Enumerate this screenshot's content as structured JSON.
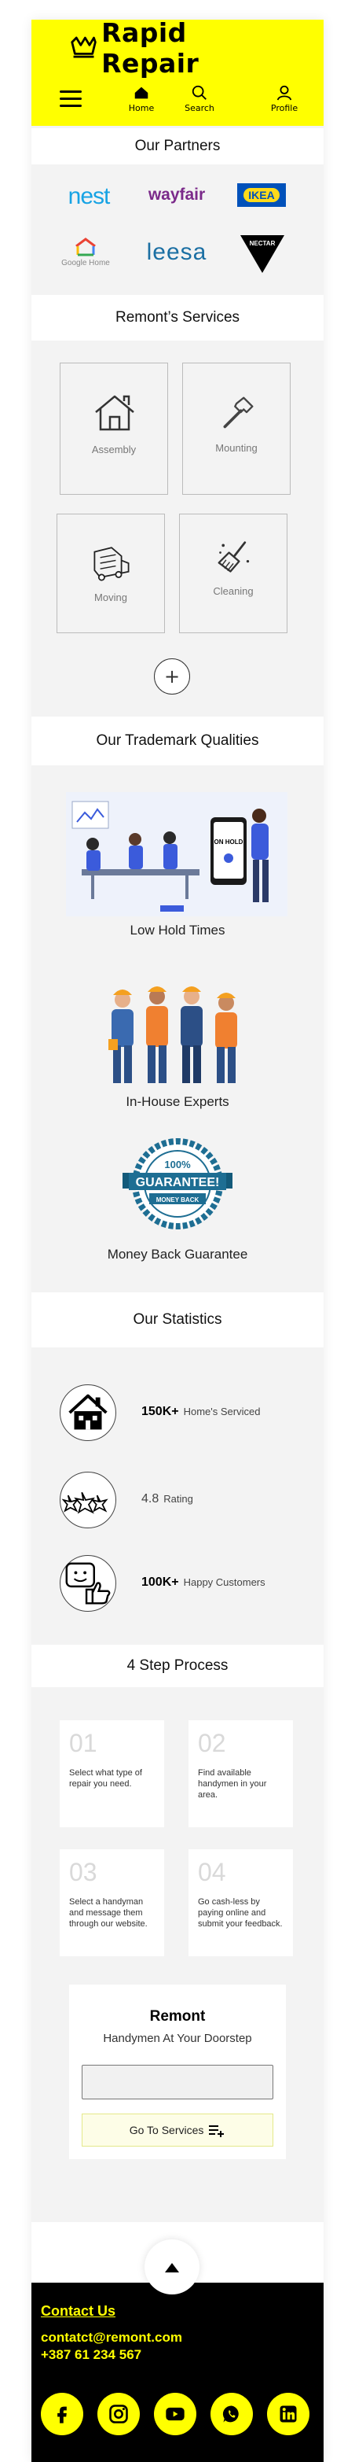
{
  "header": {
    "brand": "Rapid Repair",
    "nav": [
      {
        "label": "Home",
        "icon": "home-icon"
      },
      {
        "label": "Search",
        "icon": "search-icon"
      },
      {
        "label": "Profile",
        "icon": "profile-icon"
      }
    ]
  },
  "partners": {
    "title": "Our Partners",
    "logos": [
      "nest",
      "wayfair",
      "IKEA",
      "Google Home",
      "leesa",
      "NECTAR"
    ]
  },
  "services": {
    "title": "Remont’s  Services",
    "items": [
      {
        "label": "Assembly",
        "icon": "house-icon"
      },
      {
        "label": "Mounting",
        "icon": "hammer-icon"
      },
      {
        "label": "Moving",
        "icon": "moving-truck-icon"
      },
      {
        "label": "Cleaning",
        "icon": "broom-icon"
      }
    ],
    "more_symbol": "+"
  },
  "qualities": {
    "title": "Our Trademark Qualities",
    "items": [
      {
        "caption": "Low Hold Times",
        "phone_text": "ON HOLD"
      },
      {
        "caption": "In-House Experts"
      },
      {
        "caption": "Money Back Guarantee",
        "badge_top": "100%",
        "badge_main": "GUARANTEE!",
        "badge_bottom": "MONEY BACK"
      }
    ]
  },
  "statistics": {
    "title": "Our Statistics",
    "items": [
      {
        "value": "150K+",
        "label": "Home's Serviced",
        "icon": "house-icon"
      },
      {
        "value": "4.8",
        "label": "Rating",
        "icon": "stars-icon"
      },
      {
        "value": "100K+",
        "label": "Happy Customers",
        "icon": "happy-customer-icon"
      }
    ]
  },
  "process": {
    "title": "4 Step Process",
    "steps": [
      {
        "num": "01",
        "text": "Select what type of repair you need."
      },
      {
        "num": "02",
        "text": "Find available handymen in your area."
      },
      {
        "num": "03",
        "text": "Select a handyman and message them through our website."
      },
      {
        "num": "04",
        "text": "Go cash-less by paying online and submit your feedback."
      }
    ]
  },
  "cta": {
    "title": "Remont",
    "subtitle": "Handymen At Your Doorstep",
    "input_value": "",
    "button_label": "Go To Services"
  },
  "footer": {
    "contact_title": "Contact Us",
    "email": "contatct@remont.com",
    "phone": "+387 61 234 567",
    "socials": [
      "facebook-icon",
      "instagram-icon",
      "youtube-icon",
      "whatsapp-icon",
      "linkedin-icon"
    ]
  },
  "colors": {
    "accent": "#ffff00",
    "dark": "#000000",
    "panel": "#f3f3f3"
  }
}
